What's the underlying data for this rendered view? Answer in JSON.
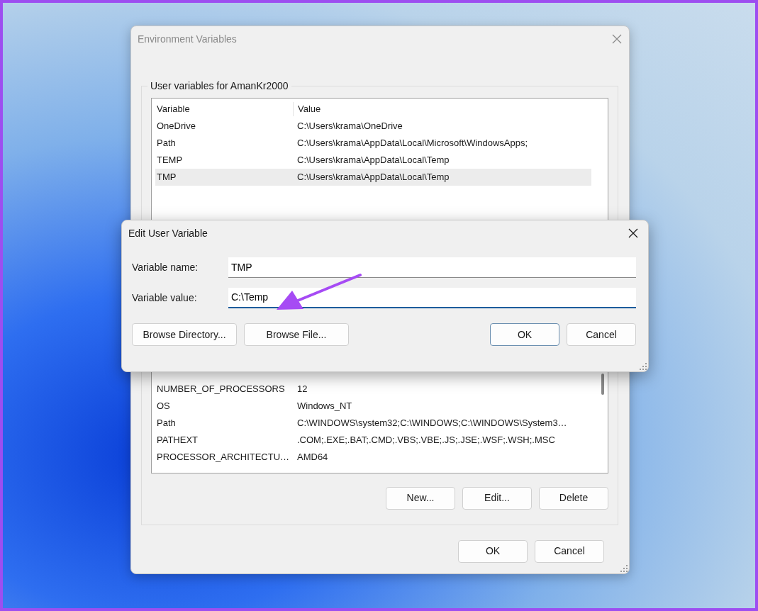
{
  "window": {
    "title": "Environment Variables"
  },
  "user_variables": {
    "title": "User variables for AmanKr2000",
    "columns": [
      "Variable",
      "Value"
    ],
    "rows": [
      {
        "variable": "OneDrive",
        "value": "C:\\Users\\krama\\OneDrive",
        "selected": false
      },
      {
        "variable": "Path",
        "value": "C:\\Users\\krama\\AppData\\Local\\Microsoft\\WindowsApps;",
        "selected": false
      },
      {
        "variable": "TEMP",
        "value": "C:\\Users\\krama\\AppData\\Local\\Temp",
        "selected": false
      },
      {
        "variable": "TMP",
        "value": "C:\\Users\\krama\\AppData\\Local\\Temp",
        "selected": true
      }
    ]
  },
  "system_variables": {
    "rows": [
      {
        "variable": "NUMBER_OF_PROCESSORS",
        "value": "12"
      },
      {
        "variable": "OS",
        "value": "Windows_NT"
      },
      {
        "variable": "Path",
        "value": "C:\\WINDOWS\\system32;C:\\WINDOWS;C:\\WINDOWS\\System3…"
      },
      {
        "variable": "PATHEXT",
        "value": ".COM;.EXE;.BAT;.CMD;.VBS;.VBE;.JS;.JSE;.WSF;.WSH;.MSC"
      },
      {
        "variable": "PROCESSOR_ARCHITECTU…",
        "value": "AMD64"
      }
    ],
    "buttons": [
      "New...",
      "Edit...",
      "Delete"
    ]
  },
  "dialog_buttons": [
    "OK",
    "Cancel"
  ],
  "edit_dialog": {
    "title": "Edit User Variable",
    "fields": [
      {
        "label": "Variable name:",
        "value": "TMP",
        "focused": false
      },
      {
        "label": "Variable value:",
        "value": "C:\\Temp",
        "focused": true
      }
    ],
    "buttons": [
      {
        "label": "Browse Directory...",
        "default": false
      },
      {
        "label": "Browse File...",
        "default": false
      },
      {
        "label": "OK",
        "default": true
      },
      {
        "label": "Cancel",
        "default": false
      }
    ]
  }
}
